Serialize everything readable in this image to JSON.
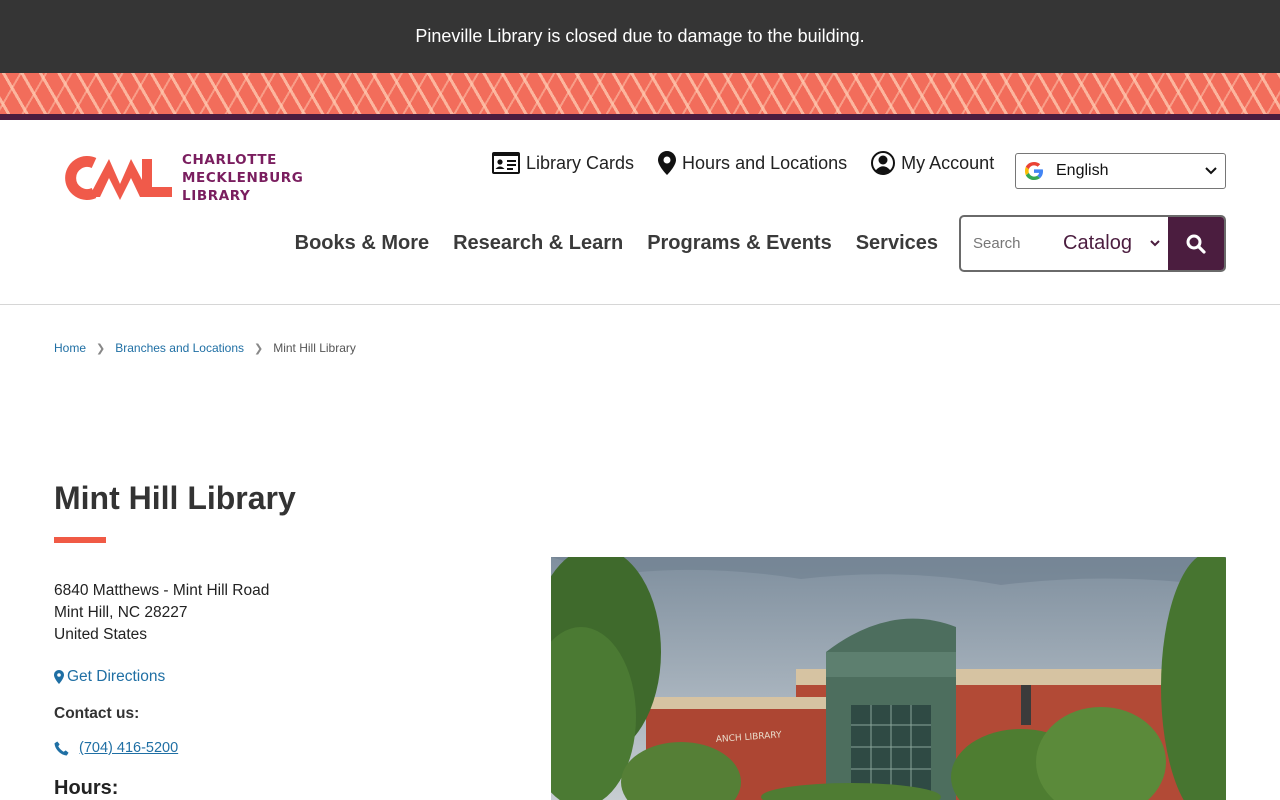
{
  "alert": {
    "message": "Pineville Library is closed due to damage to the building."
  },
  "logo": {
    "line1": "CHARLOTTE",
    "line2": "MECKLENBURG",
    "line3": "LIBRARY"
  },
  "utility_nav": {
    "library_cards": "Library Cards",
    "hours_locations": "Hours and Locations",
    "my_account": "My Account"
  },
  "language": {
    "selected": "English"
  },
  "main_nav": [
    {
      "label": "Books & More"
    },
    {
      "label": "Research & Learn"
    },
    {
      "label": "Programs & Events"
    },
    {
      "label": "Services"
    }
  ],
  "search": {
    "placeholder": "Search",
    "scope": "Catalog"
  },
  "breadcrumb": {
    "home": "Home",
    "branches": "Branches and Locations",
    "current": "Mint Hill Library"
  },
  "branch": {
    "title": "Mint Hill Library",
    "address_line1": "6840 Matthews - Mint Hill Road",
    "address_line2": "Mint Hill, NC 28227",
    "address_line3": "United States",
    "directions_label": "Get Directions",
    "contact_label": "Contact us:",
    "phone": "(704) 416-5200",
    "hours_label": "Hours:"
  },
  "photo": {
    "sign_text": "ANCH LIBRARY"
  },
  "colors": {
    "alert_bg": "#353535",
    "pattern_coral": "#f26d5b",
    "brand_plum": "#4b1d3f",
    "logo_coral": "#f05a4a",
    "logo_text": "#7a1e5f",
    "link_blue": "#1f6fa4",
    "accent_coral": "#f05a45"
  }
}
